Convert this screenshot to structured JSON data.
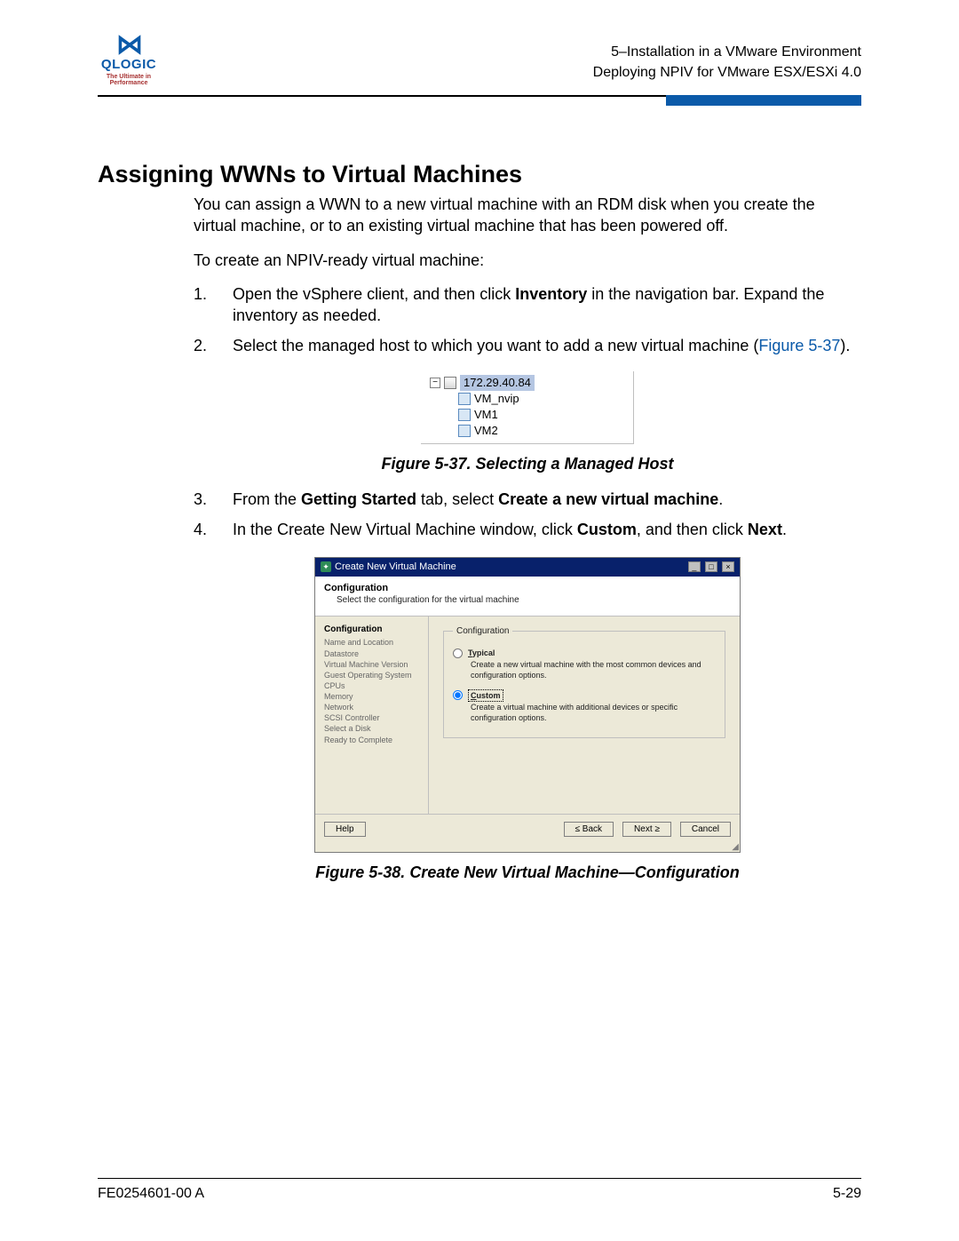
{
  "header": {
    "brand": "QLOGIC",
    "tagline": "The Ultimate in Performance",
    "chapter": "5–Installation in a VMware Environment",
    "section": "Deploying NPIV for VMware ESX/ESXi 4.0"
  },
  "title": "Assigning WWNs to Virtual Machines",
  "intro_p1": "You can assign a WWN to a new virtual machine with an RDM disk when you create the virtual machine, or to an existing virtual machine that has been powered off.",
  "intro_p2": "To create an NPIV-ready virtual machine:",
  "steps": {
    "s1a": "Open the vSphere client, and then click ",
    "s1b": "Inventory",
    "s1c": " in the navigation bar. Expand the inventory as needed.",
    "s2a": "Select the managed host to which you want to add a new virtual machine (",
    "s2b": "Figure 5-37",
    "s2c": ").",
    "s3a": "From the ",
    "s3b": "Getting Started",
    "s3c": " tab, select ",
    "s3d": "Create a new virtual machine",
    "s3e": ".",
    "s4a": "In the Create New Virtual Machine window, click ",
    "s4b": "Custom",
    "s4c": ", and then click ",
    "s4d": "Next",
    "s4e": "."
  },
  "fig37": {
    "caption": "Figure 5-37. Selecting a Managed Host",
    "host": "172.29.40.84",
    "vm1": "VM_nvip",
    "vm2": "VM1",
    "vm3": "VM2"
  },
  "fig38": {
    "caption": "Figure 5-38. Create New Virtual Machine—Configuration",
    "title": "Create New Virtual Machine",
    "heading": "Configuration",
    "subheading": "Select the configuration for the virtual machine",
    "nav": {
      "n0": "Configuration",
      "n1": "Name and Location",
      "n2": "Datastore",
      "n3": "Virtual Machine Version",
      "n4": "Guest Operating System",
      "n5": "CPUs",
      "n6": "Memory",
      "n7": "Network",
      "n8": "SCSI Controller",
      "n9": "Select a Disk",
      "n10": "Ready to Complete"
    },
    "groupbox_title": "Configuration",
    "opt_typical": "Typical",
    "opt_typical_desc": "Create a new virtual machine with the most common devices and configuration options.",
    "opt_custom": "Custom",
    "opt_custom_desc": "Create a virtual machine with additional devices or specific configuration options.",
    "btn_help": "Help",
    "btn_back": "< Back",
    "btn_next": "Next >",
    "btn_cancel": "Cancel"
  },
  "footer": {
    "doc": "FE0254601-00 A",
    "page": "5-29"
  }
}
